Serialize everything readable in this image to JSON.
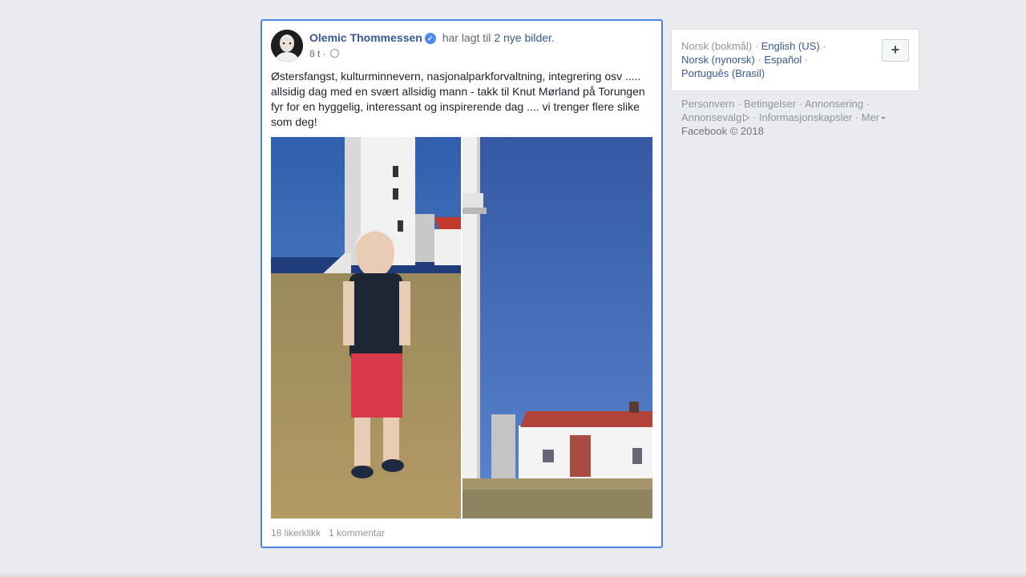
{
  "post": {
    "author": "Olemic Thommessen",
    "action_prefix": "har lagt til",
    "action_link": "2 nye bilder",
    "action_suffix": ".",
    "time": "8 t",
    "separator": "·",
    "text": "Østersfangst, kulturminnevern, nasjonalparkforvaltning, integrering osv ..... allsidig dag med en svært allsidig mann - takk til Knut Mørland på Torungen fyr for en hyggelig, interessant og inspirerende dag .... vi trenger flere slike som deg!",
    "likes": "18 likerklikk",
    "comments": "1 kommentar"
  },
  "languages": {
    "current": "Norsk (bokmål)",
    "english": "English (US)",
    "nynorsk": "Norsk (nynorsk)",
    "spanish": "Español",
    "portuguese": "Português (Brasil)",
    "dot": " · "
  },
  "footer": {
    "privacy": "Personvern",
    "terms": "Betingelser",
    "advertising": "Annonsering",
    "ad_choices": "Annonsevalg",
    "cookies": "Informasjonskapsler",
    "more": "Mer",
    "copyright": "Facebook © 2018",
    "dot": " · "
  },
  "colors": {
    "link": "#365899",
    "highlight_border": "#4a86e8",
    "background": "#e9ebee"
  }
}
